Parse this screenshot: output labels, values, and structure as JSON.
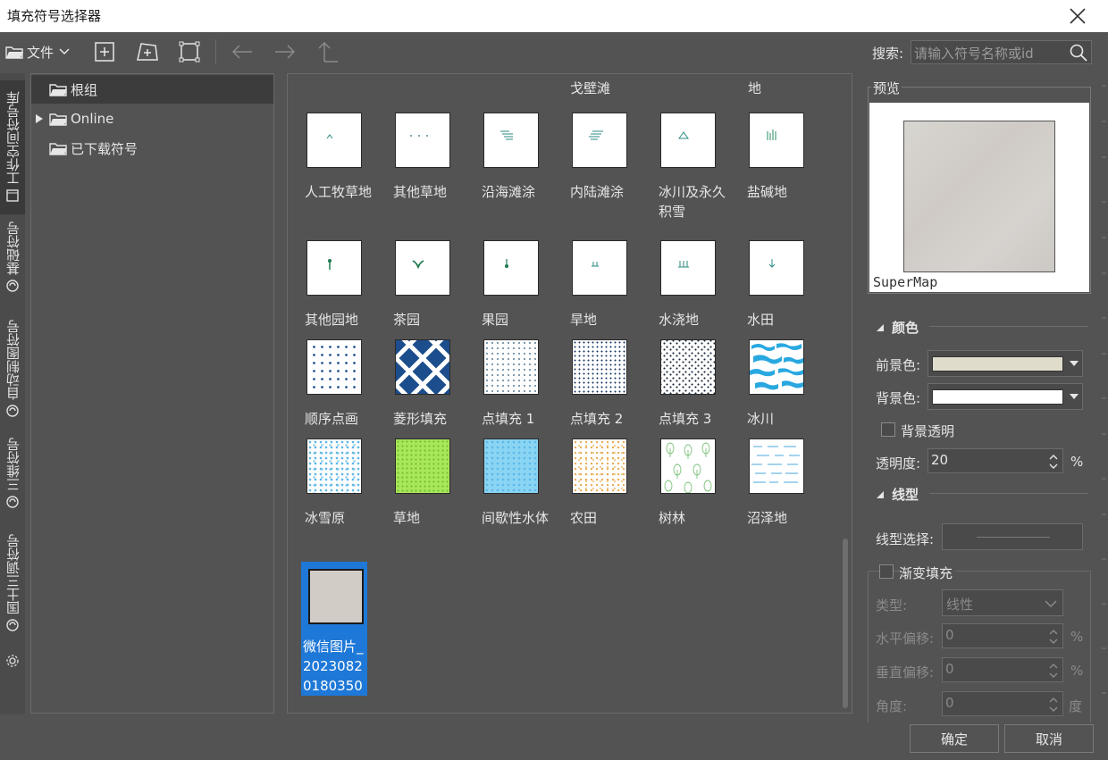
{
  "window": {
    "title": "填充符号选择器"
  },
  "toolbar": {
    "file_label": "文件"
  },
  "search": {
    "label": "搜索:",
    "placeholder": "请输入符号名称或id"
  },
  "left_tabs": [
    {
      "label": "工作空间符号库"
    },
    {
      "label": "基础符号"
    },
    {
      "label": "自动制图符号"
    },
    {
      "label": "三维符号"
    },
    {
      "label": "国土三调符号"
    }
  ],
  "tree": {
    "items": [
      {
        "label": "根组"
      },
      {
        "label": "Online"
      },
      {
        "label": "已下载符号"
      }
    ]
  },
  "grid": {
    "partial_labels": [
      "戈壁滩",
      "地"
    ],
    "symbols": [
      {
        "label": "人工牧草地",
        "icon": "grass-caret-icon"
      },
      {
        "label": "其他草地",
        "icon": "dots-icon"
      },
      {
        "label": "沿海滩涂",
        "icon": "coastal-lines-icon"
      },
      {
        "label": "内陆滩涂",
        "icon": "inland-lines-icon"
      },
      {
        "label": "冰川及永久积雪",
        "icon": "triangle-icon"
      },
      {
        "label": "盐碱地",
        "icon": "salt-bars-icon"
      },
      {
        "label": "其他园地",
        "icon": "garden-icon"
      },
      {
        "label": "茶园",
        "icon": "tea-icon"
      },
      {
        "label": "果园",
        "icon": "orchard-icon"
      },
      {
        "label": "旱地",
        "icon": "dryland-icon"
      },
      {
        "label": "水浇地",
        "icon": "irrigated-icon"
      },
      {
        "label": "水田",
        "icon": "paddy-icon"
      },
      {
        "label": "顺序点画",
        "icon": "dot-grid-icon"
      },
      {
        "label": "菱形填充",
        "icon": "diamond-pattern-icon"
      },
      {
        "label": "点填充 1",
        "icon": "dot-fill-1-icon"
      },
      {
        "label": "点填充 2",
        "icon": "dot-fill-2-icon"
      },
      {
        "label": "点填充 3",
        "icon": "dot-fill-3-icon"
      },
      {
        "label": "冰川",
        "icon": "glacier-icon"
      },
      {
        "label": "冰雪原",
        "icon": "snowfield-icon"
      },
      {
        "label": "草地",
        "icon": "grassland-icon"
      },
      {
        "label": "间歇性水体",
        "icon": "intermittent-water-icon"
      },
      {
        "label": "农田",
        "icon": "farmland-icon"
      },
      {
        "label": "树林",
        "icon": "forest-icon"
      },
      {
        "label": "沼泽地",
        "icon": "swamp-icon"
      }
    ],
    "selected": {
      "label": "微信图片_20230820180350"
    }
  },
  "preview": {
    "title": "预览",
    "caption": "SuperMap"
  },
  "color": {
    "title": "颜色",
    "foreground_label": "前景色:",
    "foreground_value": "#e0dccb",
    "background_label": "背景色:",
    "background_value": "#ffffff",
    "transparent_label": "背景透明",
    "opacity_label": "透明度:",
    "opacity_value": "20",
    "opacity_unit": "%"
  },
  "line": {
    "title": "线型",
    "select_label": "线型选择:"
  },
  "gradient": {
    "title": "渐变填充",
    "type_label": "类型:",
    "type_value": "线性",
    "h_offset_label": "水平偏移:",
    "h_offset_value": "0",
    "v_offset_label": "垂直偏移:",
    "v_offset_value": "0",
    "angle_label": "角度:",
    "angle_value": "0",
    "percent_unit": "%",
    "degree_unit": "度"
  },
  "buttons": {
    "ok": "确定",
    "cancel": "取消"
  }
}
